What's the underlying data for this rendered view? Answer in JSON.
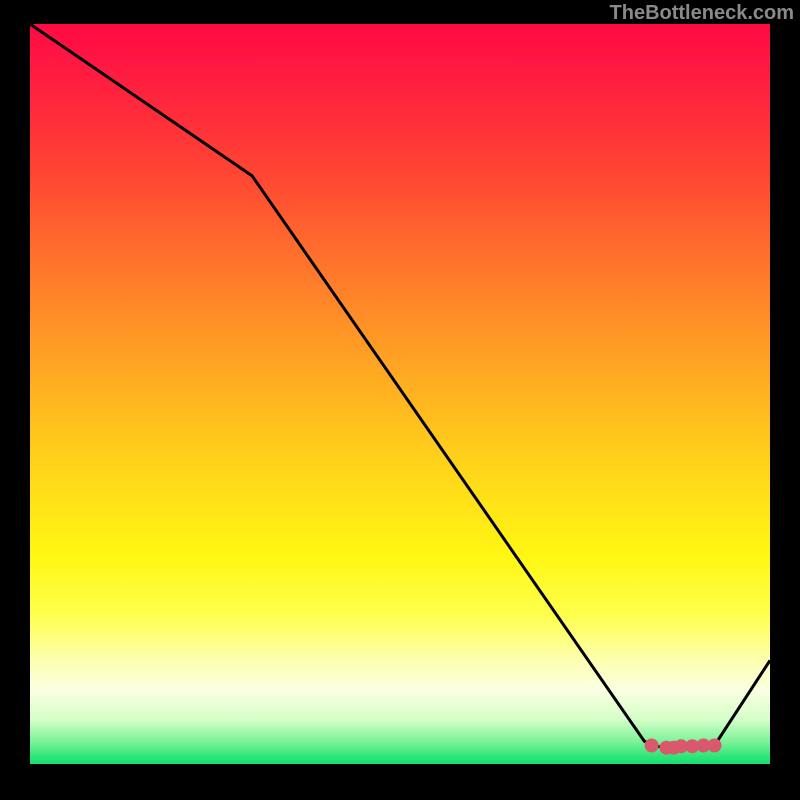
{
  "watermark": "TheBottleneck.com",
  "chart_data": {
    "type": "line",
    "title": "",
    "xlabel": "",
    "ylabel": "",
    "xlim": [
      0,
      100
    ],
    "ylim": [
      0,
      100
    ],
    "series": [
      {
        "name": "curve",
        "x": [
          0,
          30,
          83,
          84,
          86,
          87,
          88,
          89.5,
          91,
          92.5,
          100
        ],
        "y": [
          100,
          79.5,
          3.1,
          2.5,
          2.2,
          2.2,
          2.4,
          2.4,
          2.5,
          2.5,
          14
        ]
      }
    ],
    "markers": {
      "name": "points",
      "x": [
        84,
        86,
        87,
        88,
        89.5,
        91,
        92.5
      ],
      "y": [
        2.5,
        2.2,
        2.2,
        2.4,
        2.4,
        2.5,
        2.5
      ],
      "color": "#d9586c",
      "size": 7
    }
  }
}
